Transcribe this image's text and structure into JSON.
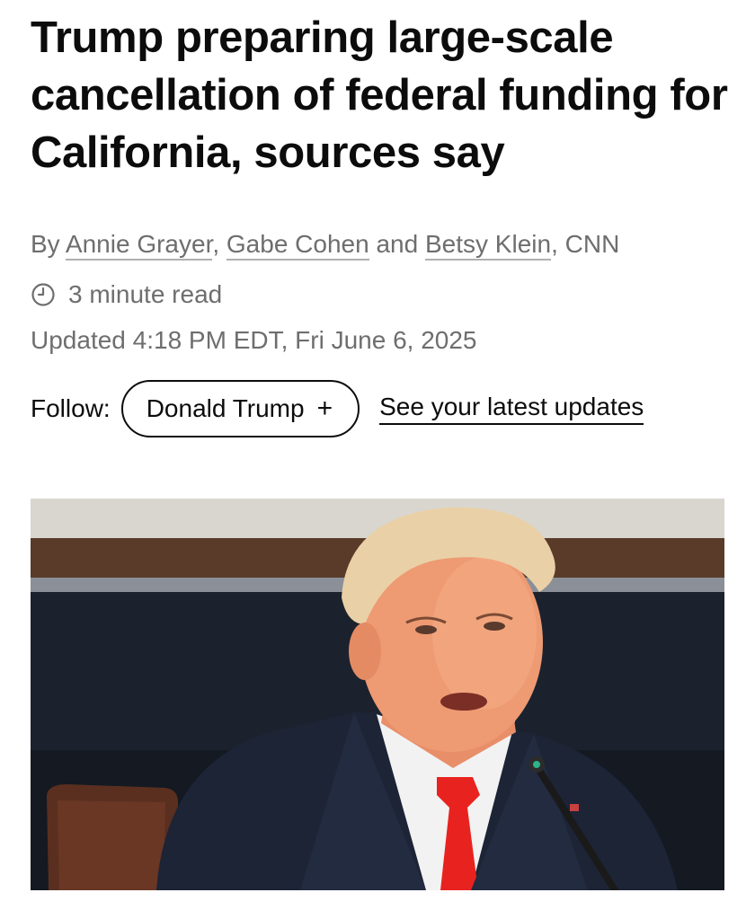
{
  "article": {
    "headline": "Trump preparing large-scale cancellation of federal funding for California, sources say",
    "byline": {
      "prefix": "By",
      "authors": [
        "Annie Grayer",
        "Gabe Cohen",
        "Betsy Klein"
      ],
      "sep1": ",",
      "and": "and",
      "outlet": ", CNN"
    },
    "read_time": "3 minute read",
    "updated": "Updated 4:18 PM EDT, Fri June 6, 2025",
    "follow": {
      "label": "Follow:",
      "topic": "Donald Trump",
      "topic_icon": "plus-icon",
      "topic_icon_glyph": "+",
      "latest_link": "See your latest updates"
    },
    "hero_image": {
      "alt_subject": "Donald Trump speaking at a microphone"
    }
  },
  "colors": {
    "text": "#0c0c0c",
    "muted": "#6e6e6e",
    "tie": "#e8231f",
    "suit": "#1c2436"
  }
}
